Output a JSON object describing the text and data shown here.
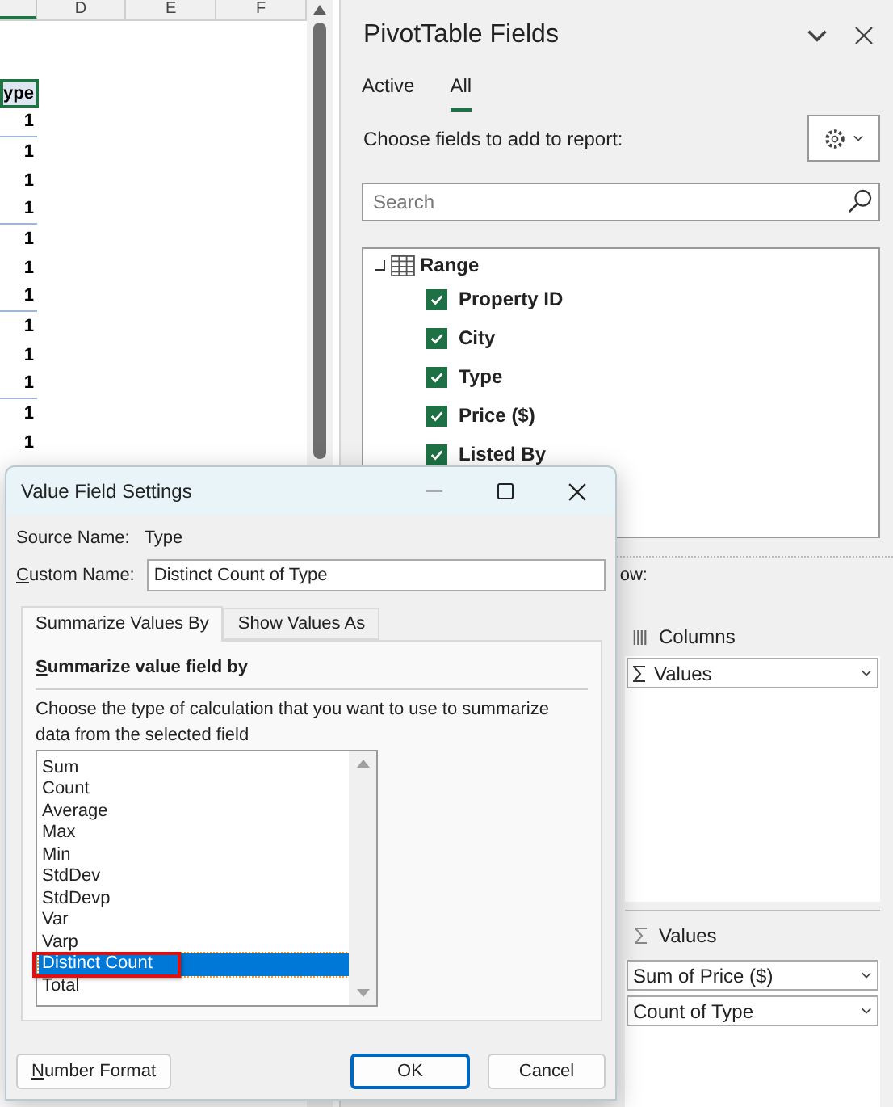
{
  "spreadsheet": {
    "columns": [
      "D",
      "E",
      "F"
    ],
    "header_cell": "ype",
    "cells": [
      "1",
      "1",
      "1",
      "1",
      "1",
      "1",
      "1",
      "1",
      "1",
      "1",
      "1",
      "1"
    ]
  },
  "pivot_panel": {
    "title": "PivotTable Fields",
    "tabs": [
      {
        "label": "Active",
        "selected": false
      },
      {
        "label": "All",
        "selected": true
      }
    ],
    "prompt": "Choose fields to add to report:",
    "search": {
      "placeholder": "Search"
    },
    "table": {
      "name": "Range",
      "expanded": true,
      "children": [
        {
          "label": "Property ID",
          "checked": true
        },
        {
          "label": "City",
          "checked": true
        },
        {
          "label": "Type",
          "checked": true
        },
        {
          "label": "Price ($)",
          "checked": true
        },
        {
          "label": "Listed By",
          "checked": true
        }
      ]
    },
    "areas_hint": "ow:",
    "columns_area": {
      "title": "Columns",
      "items": [
        "Values"
      ]
    },
    "values_area": {
      "title": "Values",
      "items": [
        "Sum of Price ($)",
        "Count of Type"
      ]
    }
  },
  "dialog": {
    "title": "Value Field Settings",
    "source_label": "Source Name:",
    "source_value": "Type",
    "custom_label": "Custom Name:",
    "custom_value": "Distinct Count of Type",
    "tabs": [
      {
        "label": "Summarize Values By",
        "selected": true
      },
      {
        "label": "Show Values As",
        "selected": false
      }
    ],
    "section_title": "Summarize value field by",
    "description": "Choose the type of calculation that you want to use to summarize data from the selected field",
    "functions": [
      {
        "label": "Sum",
        "selected": false
      },
      {
        "label": "Count",
        "selected": false
      },
      {
        "label": "Average",
        "selected": false
      },
      {
        "label": "Max",
        "selected": false
      },
      {
        "label": "Min",
        "selected": false
      },
      {
        "label": "StdDev",
        "selected": false
      },
      {
        "label": "StdDevp",
        "selected": false
      },
      {
        "label": "Var",
        "selected": false
      },
      {
        "label": "Varp",
        "selected": false
      },
      {
        "label": "Distinct Count",
        "selected": true,
        "highlighted": true
      },
      {
        "label": "Total",
        "selected": false
      }
    ],
    "buttons": [
      {
        "label": "Number Format",
        "kind": "secondary"
      },
      {
        "label": "OK",
        "kind": "default"
      },
      {
        "label": "Cancel",
        "kind": "secondary"
      }
    ]
  }
}
